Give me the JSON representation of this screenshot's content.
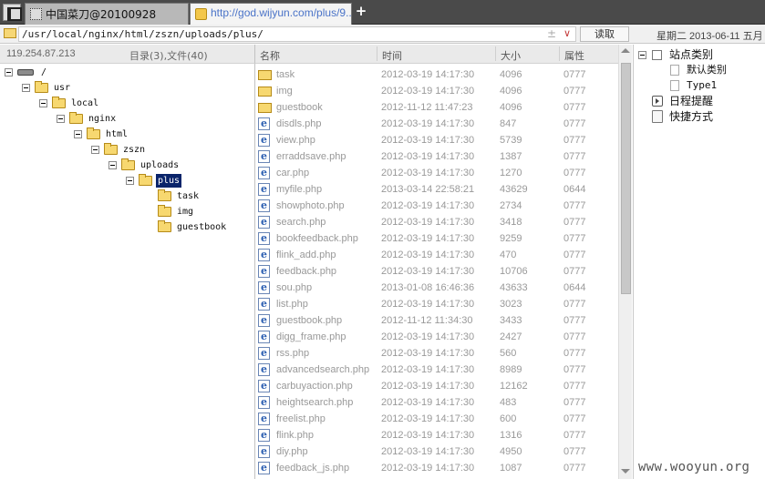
{
  "tabs": [
    {
      "label": "中国菜刀@20100928"
    },
    {
      "label": "http://god.wijyun.com/plus/9..."
    }
  ],
  "new_tab_label": "+",
  "address": {
    "path": "/usr/local/nginx/html/zszn/uploads/plus/",
    "plus": "±",
    "dropdown": "∨",
    "read_label": "读取",
    "date": "星期二 2013-06-11 五月"
  },
  "info": {
    "ip": "119.254.87.213",
    "dir_count": "目录(3),文件(40)"
  },
  "tree": [
    {
      "label": "/",
      "icon": "drive-icon"
    },
    {
      "label": "usr"
    },
    {
      "label": "local"
    },
    {
      "label": "nginx"
    },
    {
      "label": "html"
    },
    {
      "label": "zszn"
    },
    {
      "label": "uploads"
    },
    {
      "label": "plus",
      "selected": true
    },
    {
      "label": "task"
    },
    {
      "label": "img"
    },
    {
      "label": "guestbook"
    }
  ],
  "columns": {
    "name": "名称",
    "time": "时间",
    "size": "大小",
    "perm": "属性"
  },
  "files": [
    {
      "name": "task",
      "time": "2012-03-19 14:17:30",
      "size": "4096",
      "perm": "0777",
      "type": "folder"
    },
    {
      "name": "img",
      "time": "2012-03-19 14:17:30",
      "size": "4096",
      "perm": "0777",
      "type": "folder"
    },
    {
      "name": "guestbook",
      "time": "2012-11-12 11:47:23",
      "size": "4096",
      "perm": "0777",
      "type": "folder"
    },
    {
      "name": "disdls.php",
      "time": "2012-03-19 14:17:30",
      "size": "847",
      "perm": "0777",
      "type": "php"
    },
    {
      "name": "view.php",
      "time": "2012-03-19 14:17:30",
      "size": "5739",
      "perm": "0777",
      "type": "php"
    },
    {
      "name": "erraddsave.php",
      "time": "2012-03-19 14:17:30",
      "size": "1387",
      "perm": "0777",
      "type": "php"
    },
    {
      "name": "car.php",
      "time": "2012-03-19 14:17:30",
      "size": "1270",
      "perm": "0777",
      "type": "php"
    },
    {
      "name": "myfile.php",
      "time": "2013-03-14 22:58:21",
      "size": "43629",
      "perm": "0644",
      "type": "php"
    },
    {
      "name": "showphoto.php",
      "time": "2012-03-19 14:17:30",
      "size": "2734",
      "perm": "0777",
      "type": "php"
    },
    {
      "name": "search.php",
      "time": "2012-03-19 14:17:30",
      "size": "3418",
      "perm": "0777",
      "type": "php"
    },
    {
      "name": "bookfeedback.php",
      "time": "2012-03-19 14:17:30",
      "size": "9259",
      "perm": "0777",
      "type": "php"
    },
    {
      "name": "flink_add.php",
      "time": "2012-03-19 14:17:30",
      "size": "470",
      "perm": "0777",
      "type": "php"
    },
    {
      "name": "feedback.php",
      "time": "2012-03-19 14:17:30",
      "size": "10706",
      "perm": "0777",
      "type": "php"
    },
    {
      "name": "sou.php",
      "time": "2013-01-08 16:46:36",
      "size": "43633",
      "perm": "0644",
      "type": "php"
    },
    {
      "name": "list.php",
      "time": "2012-03-19 14:17:30",
      "size": "3023",
      "perm": "0777",
      "type": "php"
    },
    {
      "name": "guestbook.php",
      "time": "2012-11-12 11:34:30",
      "size": "3433",
      "perm": "0777",
      "type": "php"
    },
    {
      "name": "digg_frame.php",
      "time": "2012-03-19 14:17:30",
      "size": "2427",
      "perm": "0777",
      "type": "php"
    },
    {
      "name": "rss.php",
      "time": "2012-03-19 14:17:30",
      "size": "560",
      "perm": "0777",
      "type": "php"
    },
    {
      "name": "advancedsearch.php",
      "time": "2012-03-19 14:17:30",
      "size": "8989",
      "perm": "0777",
      "type": "php"
    },
    {
      "name": "carbuyaction.php",
      "time": "2012-03-19 14:17:30",
      "size": "12162",
      "perm": "0777",
      "type": "php"
    },
    {
      "name": "heightsearch.php",
      "time": "2012-03-19 14:17:30",
      "size": "483",
      "perm": "0777",
      "type": "php"
    },
    {
      "name": "freelist.php",
      "time": "2012-03-19 14:17:30",
      "size": "600",
      "perm": "0777",
      "type": "php"
    },
    {
      "name": "flink.php",
      "time": "2012-03-19 14:17:30",
      "size": "1316",
      "perm": "0777",
      "type": "php"
    },
    {
      "name": "diy.php",
      "time": "2012-03-19 14:17:30",
      "size": "4950",
      "perm": "0777",
      "type": "php"
    },
    {
      "name": "feedback_js.php",
      "time": "2012-03-19 14:17:30",
      "size": "1087",
      "perm": "0777",
      "type": "php"
    }
  ],
  "right_panel": {
    "site_category": "站点类别",
    "default_category": "默认类别",
    "type1": "Type1",
    "schedule": "日程提醒",
    "shortcuts": "快捷方式"
  },
  "watermark": "www.wooyun.org",
  "colors": {
    "selected_bg": "#0a246a",
    "link_tab": "#4a73c8",
    "folder": "#f7d870"
  }
}
